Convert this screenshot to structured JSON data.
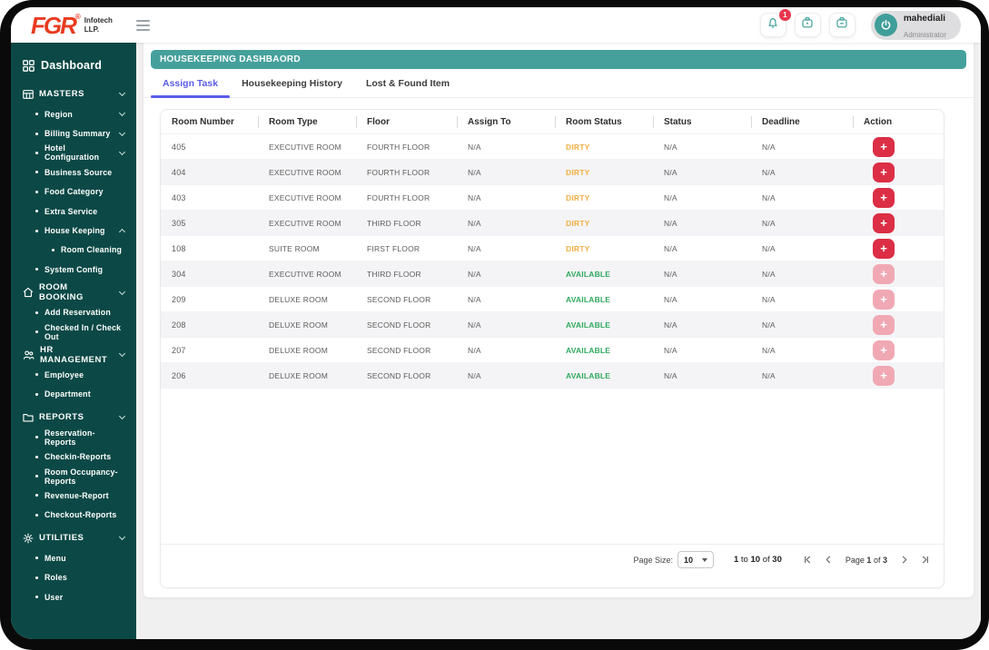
{
  "topbar": {
    "logo": {
      "brand": "FGR",
      "registered": "®",
      "line1": "Infotech",
      "line2": "LLP."
    },
    "notification_badge": "1",
    "user": {
      "name": "mahediali",
      "role": "Administrator"
    }
  },
  "sidebar": {
    "dashboard": "Dashboard",
    "sections": [
      {
        "label": "MASTERS",
        "items": [
          {
            "label": "Region"
          },
          {
            "label": "Billing Summary"
          },
          {
            "label": "Hotel Configuration"
          },
          {
            "label": "Business Source"
          },
          {
            "label": "Food Category"
          },
          {
            "label": "Extra Service"
          },
          {
            "label": "House Keeping",
            "children": [
              {
                "label": "Room Cleaning"
              }
            ]
          },
          {
            "label": "System Config"
          }
        ]
      },
      {
        "label": "ROOM BOOKING",
        "items": [
          {
            "label": "Add Reservation"
          },
          {
            "label": "Checked In / Check Out"
          }
        ]
      },
      {
        "label": "HR MANAGEMENT",
        "items": [
          {
            "label": "Employee"
          },
          {
            "label": "Department"
          }
        ]
      },
      {
        "label": "REPORTS",
        "items": [
          {
            "label": "Reservation-Reports"
          },
          {
            "label": "Checkin-Reports"
          },
          {
            "label": "Room Occupancy-Reports"
          },
          {
            "label": "Revenue-Report"
          },
          {
            "label": "Checkout-Reports"
          }
        ]
      },
      {
        "label": "UTILITIES",
        "items": [
          {
            "label": "Menu"
          },
          {
            "label": "Roles"
          },
          {
            "label": "User"
          }
        ]
      }
    ]
  },
  "main": {
    "title": "HOUSEKEEPING DASHBAORD",
    "tabs": [
      {
        "label": "Assign Task"
      },
      {
        "label": "Housekeeping History"
      },
      {
        "label": "Lost & Found Item"
      }
    ],
    "table": {
      "columns": [
        "Room Number",
        "Room Type",
        "Floor",
        "Assign To",
        "Room Status",
        "Status",
        "Deadline",
        "Action"
      ],
      "rows": [
        {
          "room_number": "405",
          "room_type": "EXECUTIVE ROOM",
          "floor": "FOURTH FLOOR",
          "assign_to": "N/A",
          "room_status": "DIRTY",
          "status": "N/A",
          "deadline": "N/A"
        },
        {
          "room_number": "404",
          "room_type": "EXECUTIVE ROOM",
          "floor": "FOURTH FLOOR",
          "assign_to": "N/A",
          "room_status": "DIRTY",
          "status": "N/A",
          "deadline": "N/A"
        },
        {
          "room_number": "403",
          "room_type": "EXECUTIVE ROOM",
          "floor": "FOURTH FLOOR",
          "assign_to": "N/A",
          "room_status": "DIRTY",
          "status": "N/A",
          "deadline": "N/A"
        },
        {
          "room_number": "305",
          "room_type": "EXECUTIVE ROOM",
          "floor": "THIRD FLOOR",
          "assign_to": "N/A",
          "room_status": "DIRTY",
          "status": "N/A",
          "deadline": "N/A"
        },
        {
          "room_number": "108",
          "room_type": "SUITE ROOM",
          "floor": "FIRST FLOOR",
          "assign_to": "N/A",
          "room_status": "DIRTY",
          "status": "N/A",
          "deadline": "N/A"
        },
        {
          "room_number": "304",
          "room_type": "EXECUTIVE ROOM",
          "floor": "THIRD FLOOR",
          "assign_to": "N/A",
          "room_status": "AVAILABLE",
          "status": "N/A",
          "deadline": "N/A"
        },
        {
          "room_number": "209",
          "room_type": "DELUXE ROOM",
          "floor": "SECOND FLOOR",
          "assign_to": "N/A",
          "room_status": "AVAILABLE",
          "status": "N/A",
          "deadline": "N/A"
        },
        {
          "room_number": "208",
          "room_type": "DELUXE ROOM",
          "floor": "SECOND FLOOR",
          "assign_to": "N/A",
          "room_status": "AVAILABLE",
          "status": "N/A",
          "deadline": "N/A"
        },
        {
          "room_number": "207",
          "room_type": "DELUXE ROOM",
          "floor": "SECOND FLOOR",
          "assign_to": "N/A",
          "room_status": "AVAILABLE",
          "status": "N/A",
          "deadline": "N/A"
        },
        {
          "room_number": "206",
          "room_type": "DELUXE ROOM",
          "floor": "SECOND FLOOR",
          "assign_to": "N/A",
          "room_status": "AVAILABLE",
          "status": "N/A",
          "deadline": "N/A"
        }
      ]
    },
    "pagination": {
      "page_size_label": "Page Size:",
      "page_size_value": "10",
      "range": {
        "from": "1",
        "to_word": "to",
        "to": "10",
        "of_word": "of",
        "total": "30"
      },
      "page": {
        "word": "Page",
        "current": "1",
        "of_word": "of",
        "total": "3"
      }
    }
  },
  "icons": {
    "plus": "+"
  },
  "colors": {
    "sidebar": "#0c4946",
    "accent_teal": "#45a09b",
    "active_tab": "#5b5ce8",
    "dirty": "#eeb044",
    "available": "#2fa95e",
    "action_red": "#dc2e44",
    "action_red_disabled": "#f0a9b4",
    "badge_red": "#e8354d"
  }
}
